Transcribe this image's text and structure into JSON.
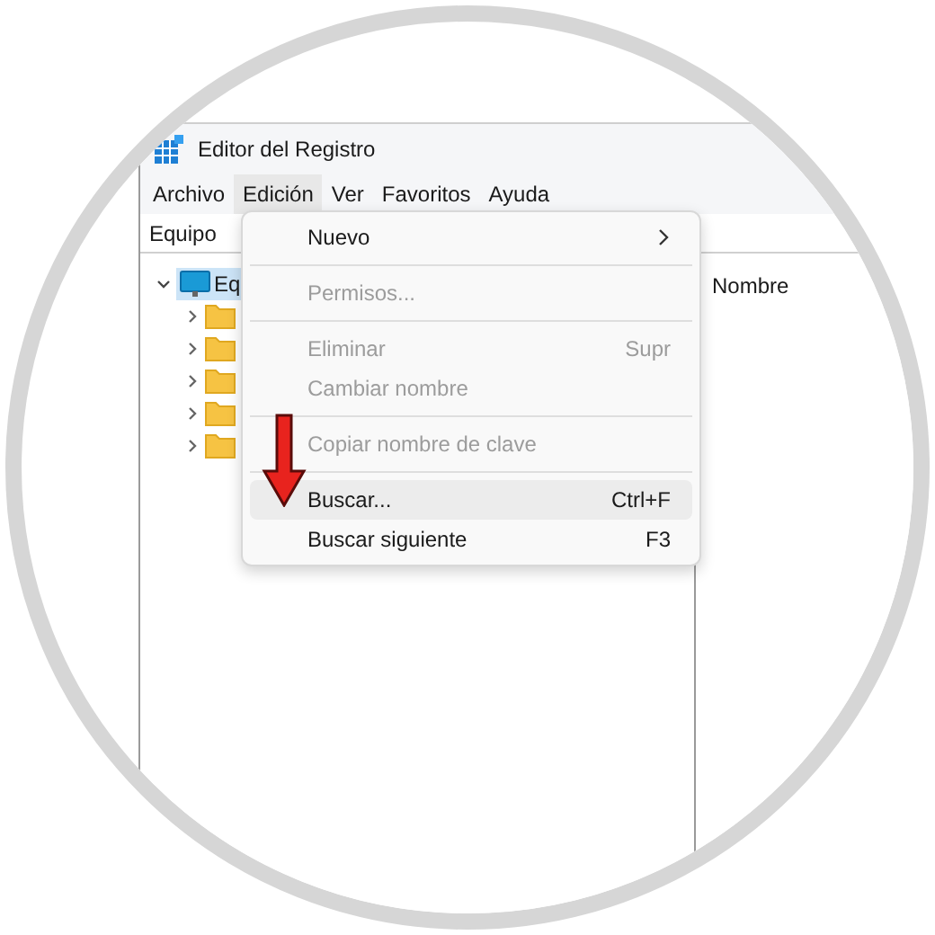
{
  "window": {
    "title": "Editor del Registro"
  },
  "menu_bar": [
    {
      "label": "Archivo",
      "selected": false
    },
    {
      "label": "Edición",
      "selected": true
    },
    {
      "label": "Ver",
      "selected": false
    },
    {
      "label": "Favoritos",
      "selected": false
    },
    {
      "label": "Ayuda",
      "selected": false
    }
  ],
  "address_bar": {
    "path": "Equipo"
  },
  "tree": {
    "label": "Eq",
    "selected": true,
    "expanded": true,
    "children": [
      {
        "kind": "folder",
        "expanded": false
      },
      {
        "kind": "folder",
        "expanded": false
      },
      {
        "kind": "folder",
        "expanded": false
      },
      {
        "kind": "folder",
        "expanded": false
      },
      {
        "kind": "folder",
        "expanded": false
      }
    ]
  },
  "values_pane": {
    "columns": [
      "Nombre"
    ]
  },
  "edit_menu": [
    {
      "kind": "item",
      "label": "Nuevo",
      "submenu": true,
      "disabled": false,
      "selected": false
    },
    {
      "kind": "separator"
    },
    {
      "kind": "item",
      "label": "Permisos...",
      "disabled": true,
      "selected": false
    },
    {
      "kind": "separator"
    },
    {
      "kind": "item",
      "label": "Eliminar",
      "shortcut": "Supr",
      "disabled": true,
      "selected": false
    },
    {
      "kind": "item",
      "label": "Cambiar nombre",
      "disabled": true,
      "selected": false
    },
    {
      "kind": "separator"
    },
    {
      "kind": "item",
      "label": "Copiar nombre de clave",
      "disabled": true,
      "selected": false
    },
    {
      "kind": "separator"
    },
    {
      "kind": "item",
      "label": "Buscar...",
      "shortcut": "Ctrl+F",
      "disabled": false,
      "selected": true
    },
    {
      "kind": "item",
      "label": "Buscar siguiente",
      "shortcut": "F3",
      "disabled": false,
      "selected": false
    }
  ]
}
